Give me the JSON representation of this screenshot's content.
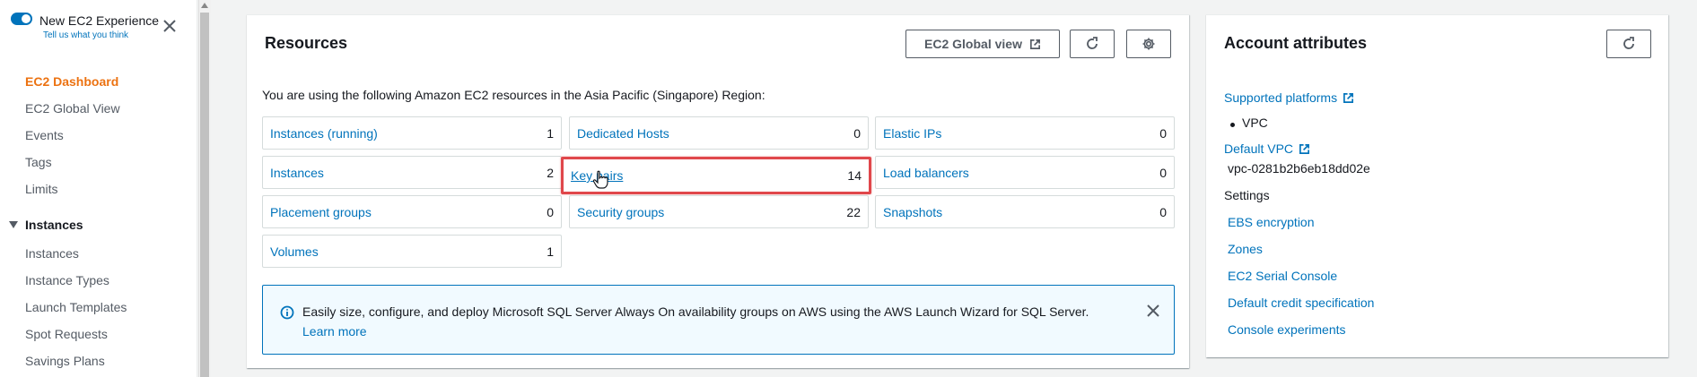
{
  "sidebar": {
    "new_experience": {
      "title": "New EC2 Experience",
      "subtitle": "Tell us what you think"
    },
    "items": [
      {
        "label": "EC2 Dashboard"
      },
      {
        "label": "EC2 Global View"
      },
      {
        "label": "Events"
      },
      {
        "label": "Tags"
      },
      {
        "label": "Limits"
      }
    ],
    "section": {
      "label": "Instances"
    },
    "sub_items": [
      {
        "label": "Instances"
      },
      {
        "label": "Instance Types"
      },
      {
        "label": "Launch Templates"
      },
      {
        "label": "Spot Requests"
      },
      {
        "label": "Savings Plans"
      }
    ]
  },
  "resources": {
    "title": "Resources",
    "global_view_button": "EC2 Global view",
    "description": "You are using the following Amazon EC2 resources in the Asia Pacific (Singapore) Region:",
    "cells": [
      {
        "label": "Instances (running)",
        "count": "1"
      },
      {
        "label": "Dedicated Hosts",
        "count": "0"
      },
      {
        "label": "Elastic IPs",
        "count": "0"
      },
      {
        "label": "Instances",
        "count": "2"
      },
      {
        "label": "Key pairs",
        "count": "14"
      },
      {
        "label": "Load balancers",
        "count": "0"
      },
      {
        "label": "Placement groups",
        "count": "0"
      },
      {
        "label": "Security groups",
        "count": "22"
      },
      {
        "label": "Snapshots",
        "count": "0"
      },
      {
        "label": "Volumes",
        "count": "1"
      }
    ],
    "info": {
      "text": "Easily size, configure, and deploy Microsoft SQL Server Always On availability groups on AWS using the AWS Launch Wizard for SQL Server.",
      "link": "Learn more"
    }
  },
  "account": {
    "title": "Account attributes",
    "supported_platforms": "Supported platforms",
    "platform_value": "VPC",
    "default_vpc": "Default VPC",
    "vpc_id": "vpc-0281b2b6eb18dd02e",
    "settings_label": "Settings",
    "settings_links": [
      {
        "label": "EBS encryption"
      },
      {
        "label": "Zones"
      },
      {
        "label": "EC2 Serial Console"
      },
      {
        "label": "Default credit specification"
      },
      {
        "label": "Console experiments"
      }
    ]
  },
  "colors": {
    "accent": "#0073bb",
    "active_nav": "#ec7211",
    "highlight_border": "#e0474b"
  },
  "icons": {
    "refresh": "refresh-icon",
    "settings": "gear-icon",
    "external": "external-link-icon",
    "info": "info-icon",
    "close": "close-icon"
  }
}
